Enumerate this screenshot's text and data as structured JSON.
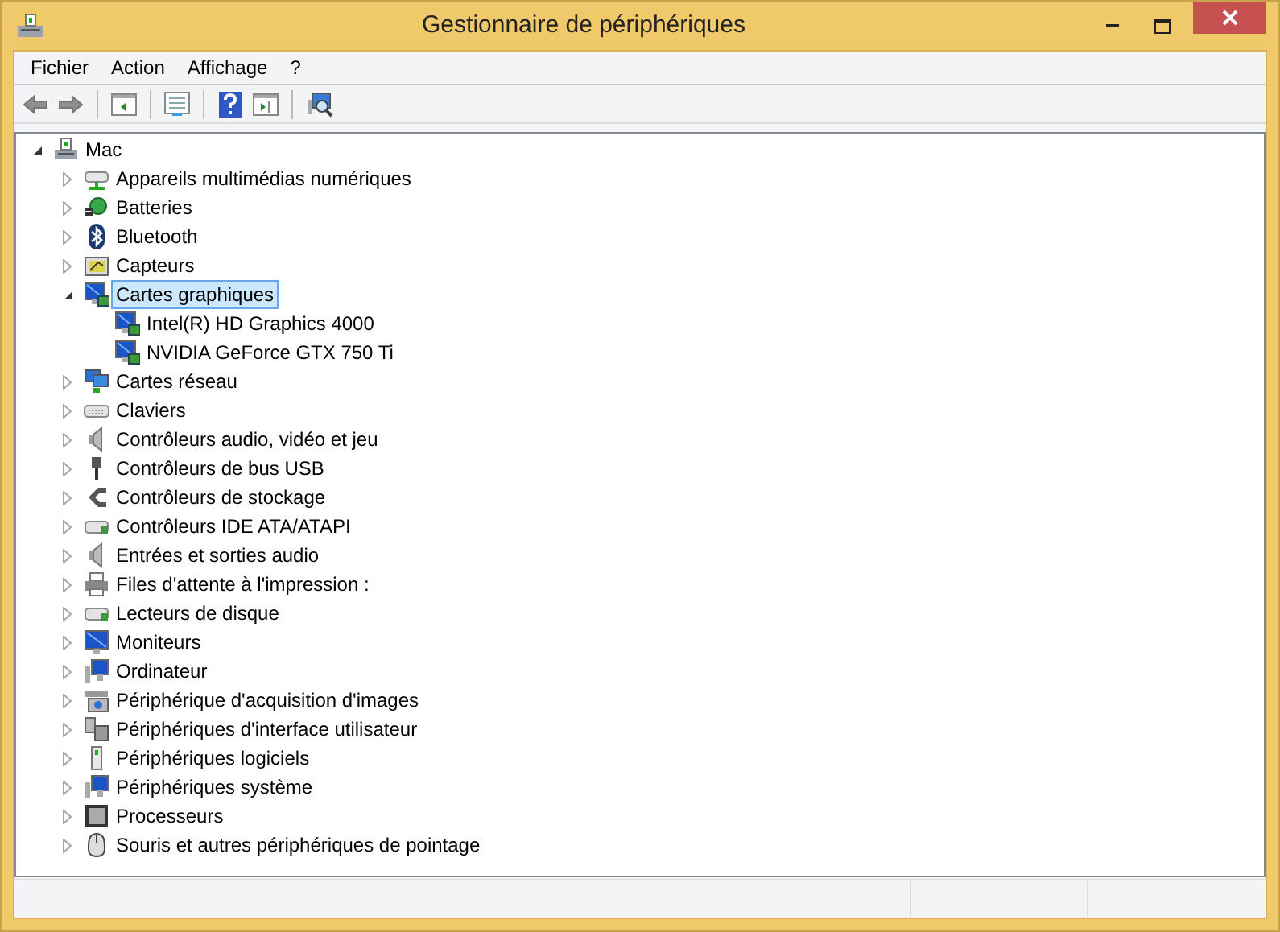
{
  "window": {
    "title": "Gestionnaire de périphériques"
  },
  "menu": [
    "Fichier",
    "Action",
    "Affichage",
    "?"
  ],
  "tree": {
    "label": "Mac",
    "expanded": true,
    "selected": false,
    "children": [
      {
        "label": "Appareils multimédias numériques",
        "expanded": false,
        "selected": false
      },
      {
        "label": "Batteries",
        "expanded": false,
        "selected": false
      },
      {
        "label": "Bluetooth",
        "expanded": false,
        "selected": false
      },
      {
        "label": "Capteurs",
        "expanded": false,
        "selected": false
      },
      {
        "label": "Cartes graphiques",
        "expanded": true,
        "selected": true,
        "children": [
          {
            "label": "Intel(R) HD Graphics 4000",
            "selected": false
          },
          {
            "label": "NVIDIA GeForce GTX 750 Ti",
            "selected": false
          }
        ]
      },
      {
        "label": "Cartes réseau",
        "expanded": false,
        "selected": false
      },
      {
        "label": "Claviers",
        "expanded": false,
        "selected": false
      },
      {
        "label": "Contrôleurs audio, vidéo et jeu",
        "expanded": false,
        "selected": false
      },
      {
        "label": "Contrôleurs de bus USB",
        "expanded": false,
        "selected": false
      },
      {
        "label": "Contrôleurs de stockage",
        "expanded": false,
        "selected": false
      },
      {
        "label": "Contrôleurs IDE ATA/ATAPI",
        "expanded": false,
        "selected": false
      },
      {
        "label": "Entrées et sorties audio",
        "expanded": false,
        "selected": false
      },
      {
        "label": "Files d'attente à l'impression :",
        "expanded": false,
        "selected": false
      },
      {
        "label": "Lecteurs de disque",
        "expanded": false,
        "selected": false
      },
      {
        "label": "Moniteurs",
        "expanded": false,
        "selected": false
      },
      {
        "label": "Ordinateur",
        "expanded": false,
        "selected": false
      },
      {
        "label": "Périphérique d'acquisition d'images",
        "expanded": false,
        "selected": false
      },
      {
        "label": "Périphériques d'interface utilisateur",
        "expanded": false,
        "selected": false
      },
      {
        "label": "Périphériques logiciels",
        "expanded": false,
        "selected": false
      },
      {
        "label": "Périphériques système",
        "expanded": false,
        "selected": false
      },
      {
        "label": "Processeurs",
        "expanded": false,
        "selected": false
      },
      {
        "label": "Souris et autres périphériques de pointage",
        "expanded": false,
        "selected": false
      }
    ]
  }
}
